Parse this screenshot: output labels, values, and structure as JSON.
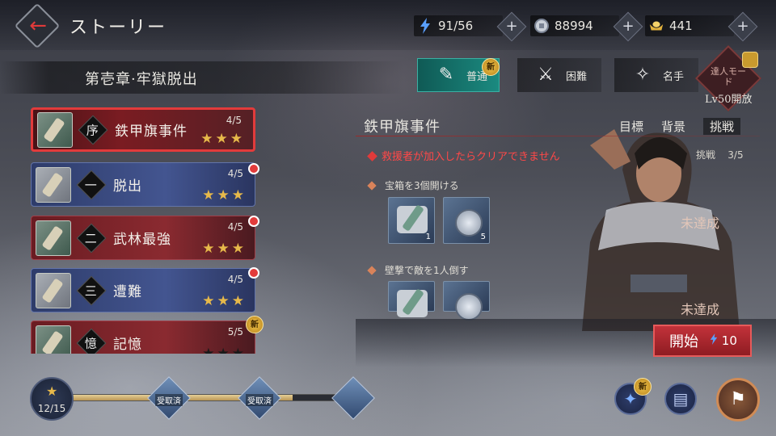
{
  "header": {
    "title": "ストーリー",
    "stamina": "91/56",
    "silver": "88994",
    "gold": "441",
    "plus": "+"
  },
  "chapter": {
    "title": "第壱章·牢獄脱出"
  },
  "difficulty": {
    "tabs": [
      {
        "label": "普通",
        "badge": "新",
        "active": true
      },
      {
        "label": "困難",
        "active": false
      },
      {
        "label": "名手",
        "active": false
      }
    ],
    "expert": {
      "label": "達人モード",
      "unlock": "Lv50開放"
    }
  },
  "stages": [
    {
      "num": "序",
      "name": "鉄甲旗事件",
      "progress": "4/5",
      "stars": "★★★",
      "style": "selected"
    },
    {
      "num": "一",
      "name": "脱出",
      "progress": "4/5",
      "stars": "★★★",
      "style": "blue",
      "dot": true
    },
    {
      "num": "二",
      "name": "武林最強",
      "progress": "4/5",
      "stars": "★★★",
      "style": "red",
      "dot": true
    },
    {
      "num": "三",
      "name": "遭難",
      "progress": "4/5",
      "stars": "★★★",
      "style": "blue",
      "dot": true
    },
    {
      "num": "憶",
      "name": "記憶",
      "progress": "5/5",
      "stars": "★★★",
      "style": "red",
      "badge": "新"
    }
  ],
  "detail": {
    "title": "鉄甲旗事件",
    "tabs": [
      "目標",
      "背景",
      "挑戦"
    ],
    "active_tab": "挑戦",
    "warning": "救援者が加入したらクリアできません",
    "challenge_label": "挑戦",
    "challenge_progress": "3/5",
    "objectives": [
      {
        "text": "宝箱を3個開ける",
        "rewards": [
          "1",
          "5"
        ],
        "status": "未達成"
      },
      {
        "text": "壁撃で敵を1人倒す",
        "status": "未達成"
      }
    ]
  },
  "start": {
    "label": "開始",
    "cost": "10"
  },
  "progress": {
    "stars": "12/15",
    "fill": 0.78,
    "chests": [
      {
        "label": "受取済"
      },
      {
        "label": "受取済"
      },
      {
        "label": ""
      }
    ]
  },
  "bottom": {
    "new_badge": "新"
  }
}
